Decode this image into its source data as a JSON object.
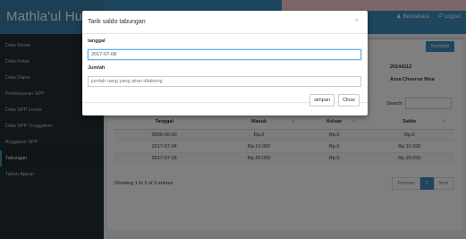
{
  "header": {
    "brand": "Mathla'ul Huda",
    "user_label": "Bendahara",
    "logout_label": "Logout"
  },
  "sidebar": {
    "items": [
      {
        "label": "Data Siswa"
      },
      {
        "label": "Data Kelas"
      },
      {
        "label": "Data Dapur"
      },
      {
        "label": "Pembayaran SPP"
      },
      {
        "label": "Data SPP Lunas"
      },
      {
        "label": "Data SPP Tunggakan"
      },
      {
        "label": "Anggaran SPP"
      },
      {
        "label": "Tabungan"
      },
      {
        "label": "Tahun Ajaran"
      }
    ],
    "active_index": 7
  },
  "main": {
    "back_button": "Kembali",
    "student_id": "20144112",
    "student_name": "Azza Choerun Nisa",
    "search_label": "Search:",
    "table": {
      "headers": [
        "Tanggal",
        "Masuk",
        "Keluar",
        "Saldo"
      ],
      "rows": [
        [
          "0000-00-00",
          "Rp.0",
          "Rp.0",
          "Rp.0"
        ],
        [
          "2017-07-04",
          "Rp.10.000",
          "Rp.0",
          "Rp.10.000"
        ],
        [
          "2017-07-05",
          "Rp.20.000",
          "Rp.0",
          "Rp.20.000"
        ]
      ]
    },
    "showing": "Showing 1 to 3 of 3 entries",
    "pager": {
      "prev": "Previous",
      "current": "1",
      "next": "Next"
    }
  },
  "modal": {
    "title": "Tarik saldo tabungan",
    "close_glyph": "×",
    "date_label": "tanggal",
    "date_value": "2017-07-08",
    "amount_label": "Jumlah",
    "amount_placeholder": "jumlah uang yang akan ditabung",
    "save_label": "simpan",
    "close_label": "Close"
  },
  "colors": {
    "primary": "#3c8dbc",
    "sidebar_bg": "#222d32"
  }
}
